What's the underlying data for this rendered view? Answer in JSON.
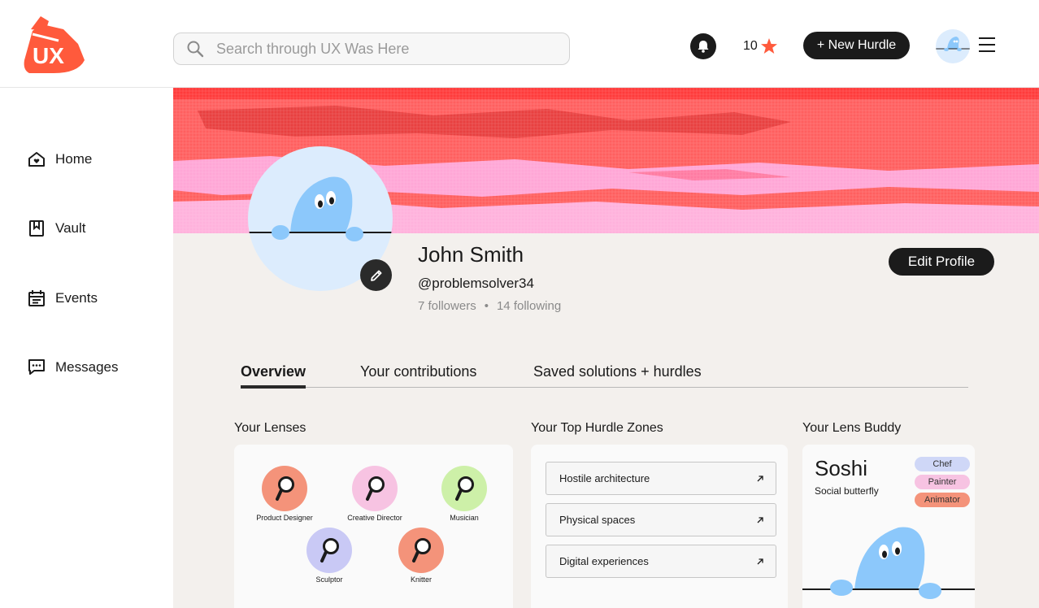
{
  "header": {
    "logo_text": "UX",
    "search_placeholder": "Search through UX Was Here",
    "points": "10",
    "new_hurdle_label": "+ New Hurdle"
  },
  "sidebar": {
    "items": [
      {
        "label": "Home",
        "icon": "home-heart-icon"
      },
      {
        "label": "Vault",
        "icon": "bookmark-icon"
      },
      {
        "label": "Events",
        "icon": "calendar-icon"
      },
      {
        "label": "Messages",
        "icon": "message-icon"
      }
    ]
  },
  "profile": {
    "name": "John Smith",
    "handle": "@problemsolver34",
    "followers": "7 followers",
    "separator": "•",
    "following": "14 following",
    "edit_label": "Edit Profile"
  },
  "tabs": [
    {
      "label": "Overview",
      "active": true
    },
    {
      "label": "Your contributions",
      "active": false
    },
    {
      "label": "Saved solutions + hurdles",
      "active": false
    }
  ],
  "lenses": {
    "title": "Your Lenses",
    "items": [
      {
        "label": "Product Designer",
        "color": "#f4937a"
      },
      {
        "label": "Creative Director",
        "color": "#f7c3e2"
      },
      {
        "label": "Musician",
        "color": "#cdf0a8"
      },
      {
        "label": "Sculptor",
        "color": "#c9c9f5"
      },
      {
        "label": "Knitter",
        "color": "#f4937a"
      }
    ]
  },
  "zones": {
    "title": "Your Top Hurdle Zones",
    "items": [
      "Hostile architecture",
      "Physical spaces",
      "Digital experiences"
    ]
  },
  "buddy": {
    "title": "Your Lens Buddy",
    "name": "Soshi",
    "description": "Social butterfly",
    "tags": [
      {
        "label": "Chef",
        "color": "#cfd7f7"
      },
      {
        "label": "Painter",
        "color": "#f7c3e2"
      },
      {
        "label": "Animator",
        "color": "#f4937a"
      }
    ]
  },
  "colors": {
    "accent": "#ff5a3c",
    "dark": "#1b1b1b",
    "banner_red": "#ff5a5a",
    "banner_pink": "#ffa6d6",
    "mascot_blue": "#8cc8fb",
    "avatar_bg": "#dcecfd"
  }
}
